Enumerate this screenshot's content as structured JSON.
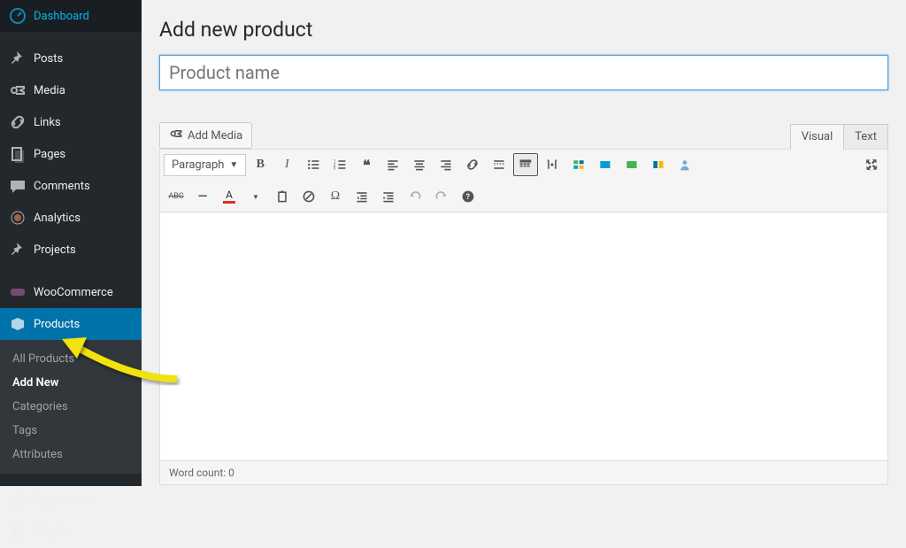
{
  "sidebar": {
    "items": [
      {
        "label": "Dashboard"
      },
      {
        "label": "Posts"
      },
      {
        "label": "Media"
      },
      {
        "label": "Links"
      },
      {
        "label": "Pages"
      },
      {
        "label": "Comments"
      },
      {
        "label": "Analytics"
      },
      {
        "label": "Projects"
      },
      {
        "label": "WooCommerce"
      },
      {
        "label": "Products"
      },
      {
        "label": "Appearance"
      },
      {
        "label": "Plugins"
      }
    ],
    "submenu": [
      {
        "label": "All Products"
      },
      {
        "label": "Add New"
      },
      {
        "label": "Categories"
      },
      {
        "label": "Tags"
      },
      {
        "label": "Attributes"
      }
    ]
  },
  "page": {
    "heading": "Add new product",
    "title_placeholder": "Product name",
    "add_media": "Add Media",
    "tab_visual": "Visual",
    "tab_text": "Text",
    "paragraph": "Paragraph",
    "abc": "ABC",
    "letter_a": "A",
    "word_count_label": "Word count: 0"
  }
}
